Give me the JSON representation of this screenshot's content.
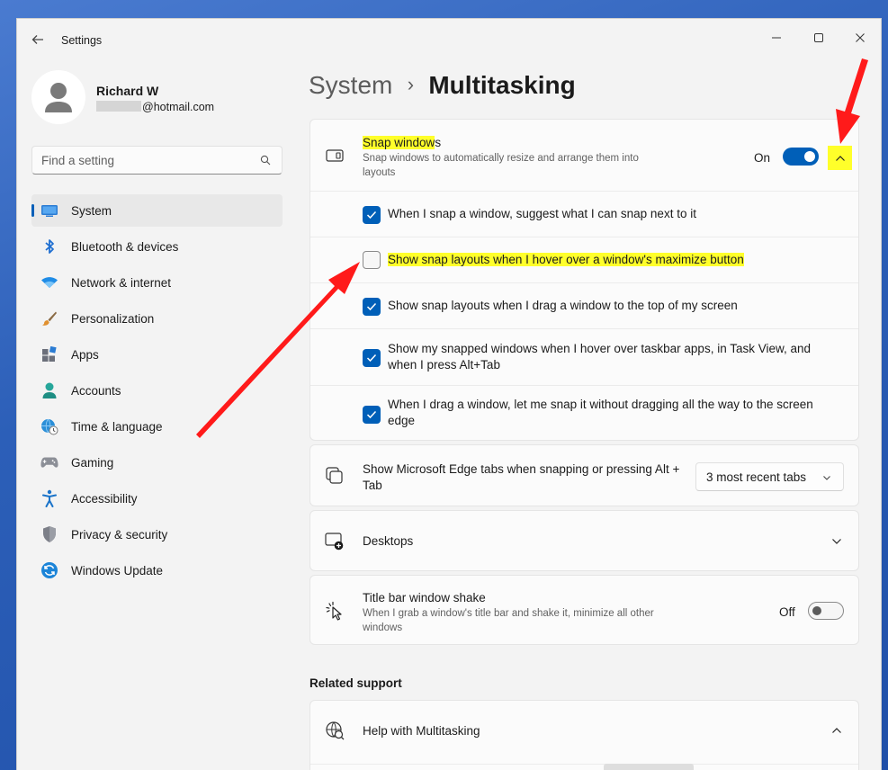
{
  "window": {
    "title": "Settings"
  },
  "profile": {
    "name": "Richard W",
    "email_domain": "@hotmail.com"
  },
  "search": {
    "placeholder": "Find a setting"
  },
  "sidebar": {
    "items": [
      {
        "label": "System",
        "icon": "system-icon",
        "active": true
      },
      {
        "label": "Bluetooth & devices",
        "icon": "bluetooth-icon"
      },
      {
        "label": "Network & internet",
        "icon": "wifi-icon"
      },
      {
        "label": "Personalization",
        "icon": "brush-icon"
      },
      {
        "label": "Apps",
        "icon": "apps-icon"
      },
      {
        "label": "Accounts",
        "icon": "accounts-icon"
      },
      {
        "label": "Time & language",
        "icon": "globe-clock-icon"
      },
      {
        "label": "Gaming",
        "icon": "gamepad-icon"
      },
      {
        "label": "Accessibility",
        "icon": "accessibility-icon"
      },
      {
        "label": "Privacy & security",
        "icon": "shield-icon"
      },
      {
        "label": "Windows Update",
        "icon": "update-icon"
      }
    ]
  },
  "breadcrumb": {
    "parent": "System",
    "separator": "›",
    "current": "Multitasking"
  },
  "snap": {
    "title_highlighted": "Snap window",
    "title_rest": "s",
    "description": "Snap windows to automatically resize and arrange them into layouts",
    "state_label": "On",
    "options": [
      {
        "label": "When I snap a window, suggest what I can snap next to it",
        "checked": true
      },
      {
        "label": "Show snap layouts when I hover over a window's maximize button",
        "checked": false
      },
      {
        "label": "Show snap layouts when I drag a window to the top of my screen",
        "checked": true
      },
      {
        "label": "Show my snapped windows when I hover over taskbar apps, in Task View, and when I press Alt+Tab",
        "checked": true
      },
      {
        "label": "When I drag a window, let me snap it without dragging all the way to the screen edge",
        "checked": true
      }
    ]
  },
  "edge_tabs": {
    "title": "Show Microsoft Edge tabs when snapping or pressing Alt + Tab",
    "selected": "3 most recent tabs"
  },
  "desktops": {
    "title": "Desktops"
  },
  "shake": {
    "title": "Title bar window shake",
    "description": "When I grab a window's title bar and shake it, minimize all other windows",
    "state_label": "Off"
  },
  "related": {
    "heading": "Related support",
    "help_title": "Help with Multitasking"
  },
  "colors": {
    "accent": "#005fb8",
    "highlight": "#ffff2a",
    "annotation_arrow": "#ff1a1a"
  }
}
